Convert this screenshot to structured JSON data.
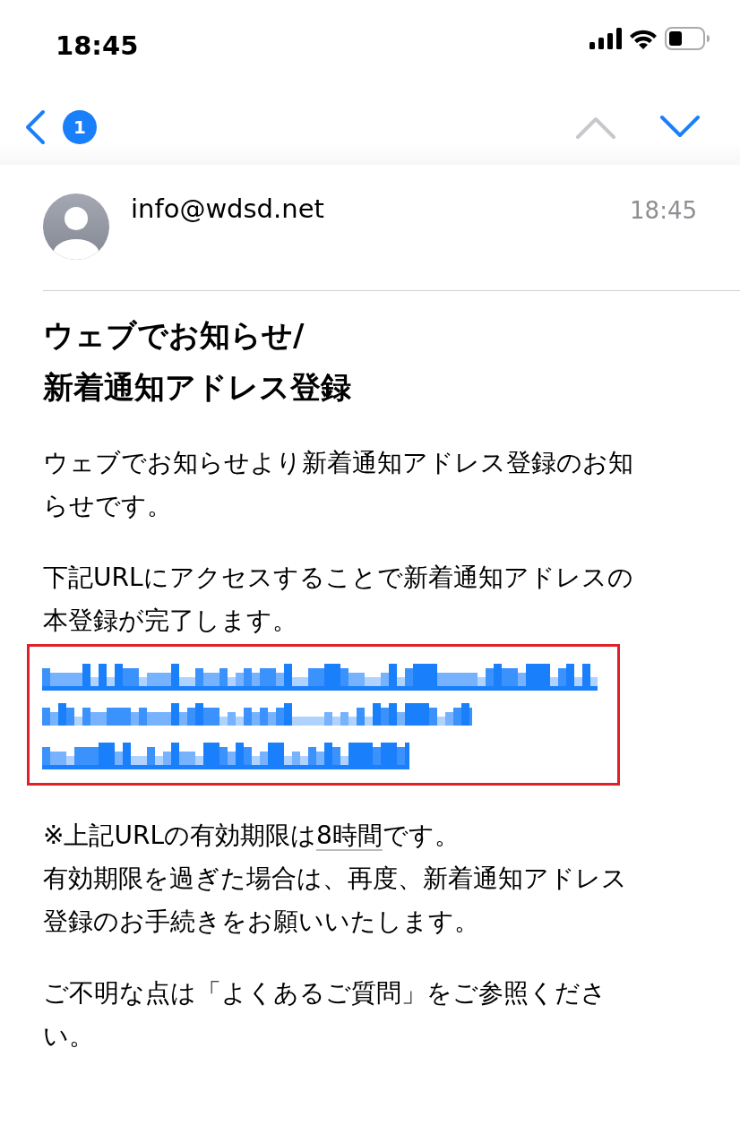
{
  "status_bar": {
    "time": "18:45"
  },
  "nav": {
    "unread_count": "1",
    "previous_enabled": false,
    "next_enabled": true
  },
  "message": {
    "sender": "info@wdsd.net",
    "time": "18:45",
    "subject_lines": [
      "ウェブでお知らせ/",
      "新着通知アドレス登録"
    ],
    "blocks": [
      {
        "kind": "paragraph",
        "lines": [
          [
            {
              "kind": "text",
              "text": "ウェブでお知らせより新着通知アドレス登録のお知"
            }
          ],
          [
            {
              "kind": "text",
              "text": "らせです。"
            }
          ]
        ]
      },
      {
        "kind": "paragraph",
        "lines": [
          [
            {
              "kind": "text",
              "text": "下記URLにアクセスすることで新着通知アドレスの"
            }
          ],
          [
            {
              "kind": "text",
              "text": "本登録が完了します。"
            }
          ]
        ]
      },
      {
        "kind": "redacted_link",
        "highlighted": true,
        "lines": [
          {
            "kind": "pixelated"
          },
          {
            "kind": "pixelated"
          },
          {
            "kind": "pixelated"
          }
        ]
      },
      {
        "kind": "paragraph",
        "lines": [
          [
            {
              "kind": "text",
              "text": "※上記URLの有効期限は"
            },
            {
              "kind": "link",
              "text": "8時間"
            },
            {
              "kind": "text",
              "text": "です。"
            }
          ],
          [
            {
              "kind": "text",
              "text": "有効期限を過ぎた場合は、再度、新着通知アドレス"
            }
          ],
          [
            {
              "kind": "text",
              "text": "登録のお手続きをお願いいたします。"
            }
          ]
        ]
      },
      {
        "kind": "paragraph",
        "lines": [
          [
            {
              "kind": "text",
              "text": "ご不明な点は「よくあるご質問」をご参照くださ"
            }
          ],
          [
            {
              "kind": "text",
              "text": "い。"
            }
          ]
        ]
      }
    ]
  }
}
